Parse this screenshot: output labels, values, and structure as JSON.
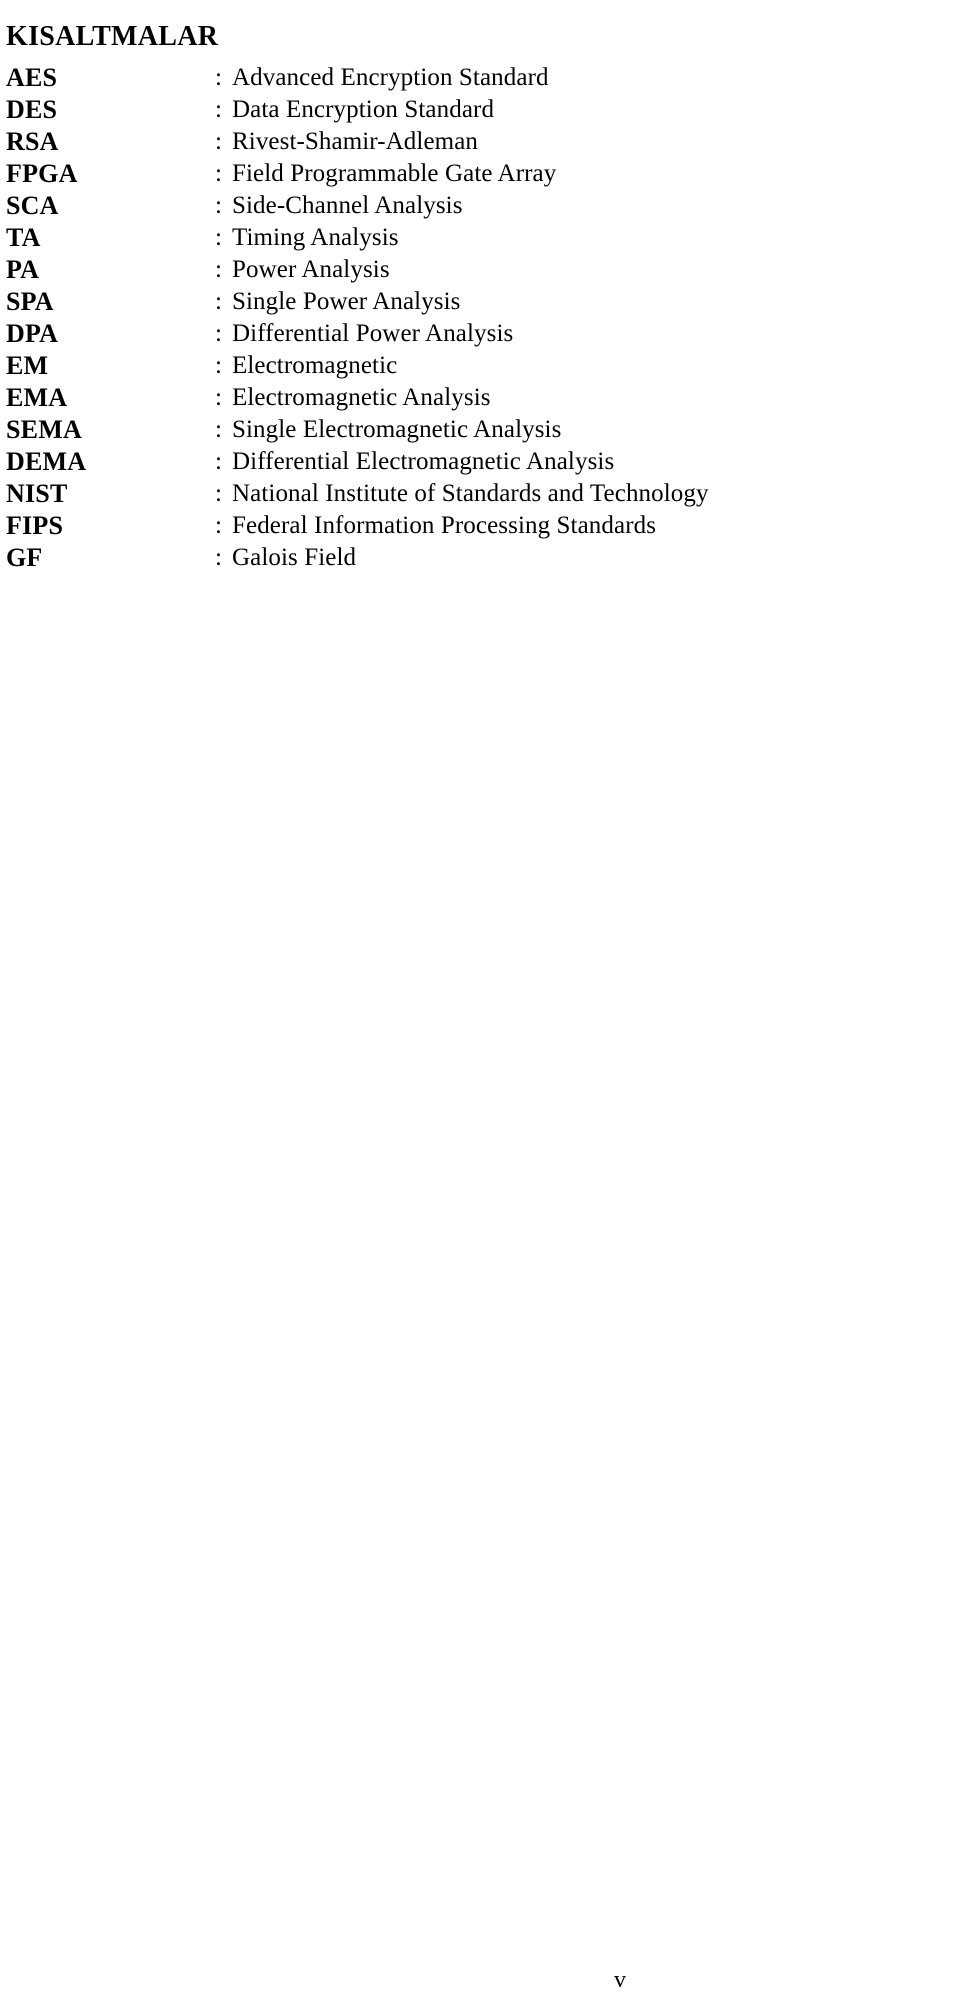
{
  "document": {
    "title": "KISALTMALAR",
    "separator": ":",
    "page_number": "v",
    "abbreviations": [
      {
        "term": "AES",
        "definition": "Advanced Encryption Standard"
      },
      {
        "term": "DES",
        "definition": "Data Encryption Standard"
      },
      {
        "term": "RSA",
        "definition": "Rivest-Shamir-Adleman"
      },
      {
        "term": "FPGA",
        "definition": "Field Programmable Gate Array"
      },
      {
        "term": "SCA",
        "definition": "Side-Channel Analysis"
      },
      {
        "term": "TA",
        "definition": "Timing Analysis"
      },
      {
        "term": "PA",
        "definition": "Power Analysis"
      },
      {
        "term": "SPA",
        "definition": "Single Power Analysis"
      },
      {
        "term": "DPA",
        "definition": "Differential Power Analysis"
      },
      {
        "term": "EM",
        "definition": "Electromagnetic"
      },
      {
        "term": "EMA",
        "definition": "Electromagnetic Analysis"
      },
      {
        "term": "SEMA",
        "definition": "Single Electromagnetic Analysis"
      },
      {
        "term": "DEMA",
        "definition": "Differential Electromagnetic Analysis"
      },
      {
        "term": "NIST",
        "definition": "National Institute of Standards and Technology"
      },
      {
        "term": "FIPS",
        "definition": "Federal Information Processing Standards"
      },
      {
        "term": "GF",
        "definition": "Galois Field"
      }
    ]
  }
}
